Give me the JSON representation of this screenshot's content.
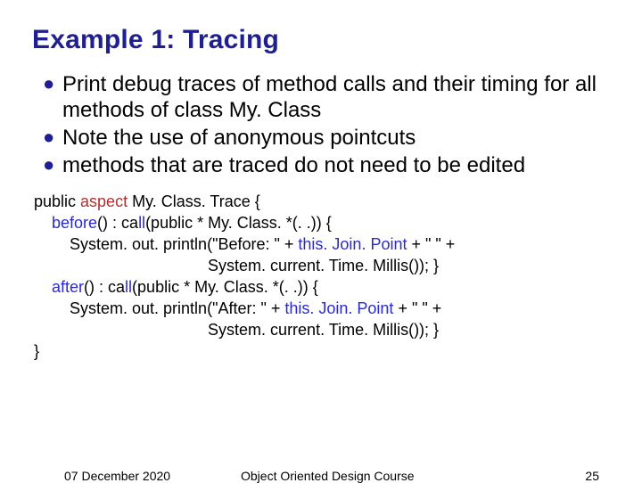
{
  "title": "Example 1: Tracing",
  "bullets": [
    "Print debug traces of method calls and their timing for all methods of class My. Class",
    "Note the use of anonymous pointcuts",
    "methods that are traced do not need to be edited"
  ],
  "code": {
    "l0a": "public ",
    "l0_aspect": "aspect",
    "l0b": " My. Class. Trace {",
    "l1a": "    before",
    "l1b": "() : ca",
    "l1_ll": "ll",
    "l1c": "(public * My. Class. *(. .)) {",
    "l2a": "        System. out. println(\"Before: \" + ",
    "l2_tj": "this. Join. Point",
    "l2b": " + \" \" +",
    "l3": "                                       System. current. Time. Millis()); }",
    "l4a": "    after",
    "l4b": "() : ca",
    "l4_ll": "ll",
    "l4c": "(public * My. Class. *(. .)) {",
    "l5a": "        System. out. println(\"After: \" + ",
    "l5_tj": "this. Join. Point",
    "l5b": " + \" \" +",
    "l6": "                                       System. current. Time. Millis()); }",
    "l7": "}"
  },
  "footer": {
    "date": "07 December 2020",
    "course": "Object Oriented Design Course",
    "page": "25"
  }
}
